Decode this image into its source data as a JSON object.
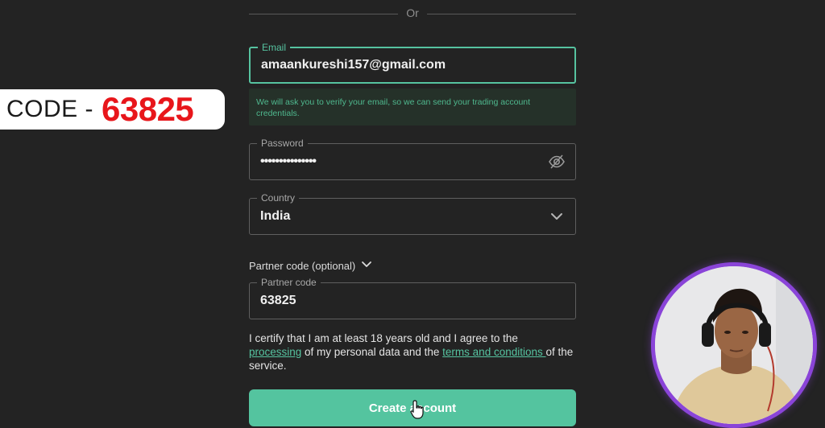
{
  "separator": {
    "label": "Or"
  },
  "form": {
    "email": {
      "label": "Email",
      "value": "amaankureshi157@gmail.com"
    },
    "email_hint": "We will ask you to verify your email, so we can send your trading account credentials.",
    "password": {
      "label": "Password",
      "value": "•••••••••••••••",
      "toggle_icon": "eye-off-icon"
    },
    "country": {
      "label": "Country",
      "value": "India",
      "dropdown_icon": "chevron-down-icon"
    },
    "partner_toggle": {
      "label": "Partner code (optional)",
      "icon": "chevron-down-icon"
    },
    "partner_code": {
      "label": "Partner code",
      "value": "63825"
    },
    "certify": {
      "text_1": "I certify that I am at least 18 years old and I agree to the",
      "link_1": "processing",
      "text_2": " of my personal data and the ",
      "link_2": "terms and conditions ",
      "text_3": "of the service."
    },
    "submit_label": "Create account"
  },
  "overlay": {
    "code_label": "CODE -",
    "code_value": "63825"
  },
  "colors": {
    "background": "#232323",
    "accent": "#56c3a0",
    "hint_background": "#253129",
    "code_red": "#e8161b",
    "webcam_ring": "#8a44d8"
  }
}
